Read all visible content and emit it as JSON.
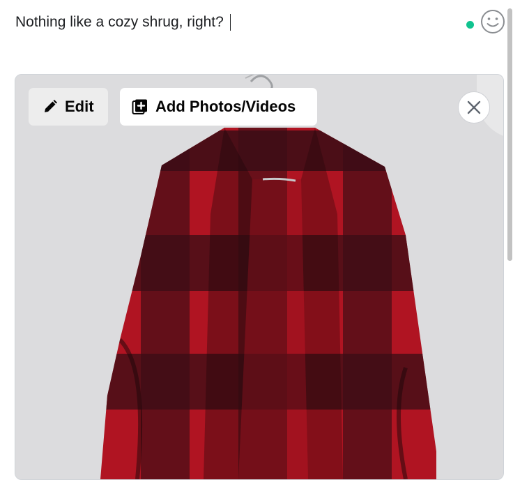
{
  "composer": {
    "text": "Nothing like a cozy shrug, right?"
  },
  "icons": {
    "emoji": "smiley-face-icon",
    "edit": "pencil-icon",
    "add_media": "add-photo-icon",
    "close": "close-icon"
  },
  "colors": {
    "status_dot": "#10c38f",
    "plaid_red": "#b01422",
    "plaid_dark": "#3a0d15"
  },
  "media": {
    "edit_label": "Edit",
    "add_label": "Add Photos/Videos"
  }
}
